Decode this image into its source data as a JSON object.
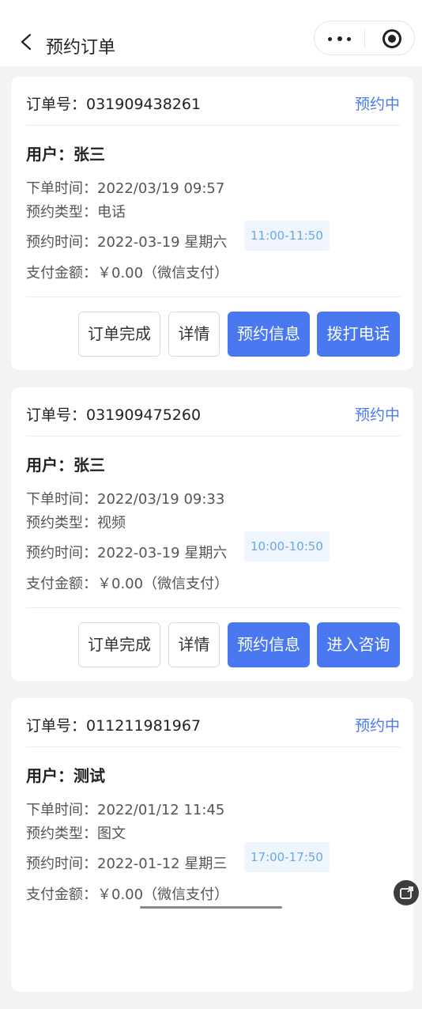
{
  "nav": {
    "title": "预约订单"
  },
  "colors": {
    "accent": "#4a78f0",
    "slot_bg": "#eef5fc",
    "slot_text": "#6aa6e8"
  },
  "orders": [
    {
      "order_no": "订单号：031909438261",
      "status": "预约中",
      "user": "用户：张三",
      "order_time": "下单时间：2022/03/19 09:57",
      "type": "预约类型：电话",
      "appt_time": "预约时间：2022-03-19 星期六",
      "slot": "11:00-11:50",
      "pay": "支付金额：￥0.00（微信支付）",
      "buttons": [
        "订单完成",
        "详情",
        "预约信息",
        "拨打电话"
      ]
    },
    {
      "order_no": "订单号：031909475260",
      "status": "预约中",
      "user": "用户：张三",
      "order_time": "下单时间：2022/03/19 09:33",
      "type": "预约类型：视频",
      "appt_time": "预约时间：2022-03-19 星期六",
      "slot": "10:00-10:50",
      "pay": "支付金额：￥0.00（微信支付）",
      "buttons": [
        "订单完成",
        "详情",
        "预约信息",
        "进入咨询"
      ]
    },
    {
      "order_no": "订单号：011211981967",
      "status": "预约中",
      "user": "用户：测试",
      "order_time": "下单时间：2022/01/12 11:45",
      "type": "预约类型：图文",
      "appt_time": "预约时间：2022-01-12 星期三",
      "slot": "17:00-17:50",
      "pay": "支付金额：￥0.00（微信支付）",
      "buttons": []
    }
  ]
}
